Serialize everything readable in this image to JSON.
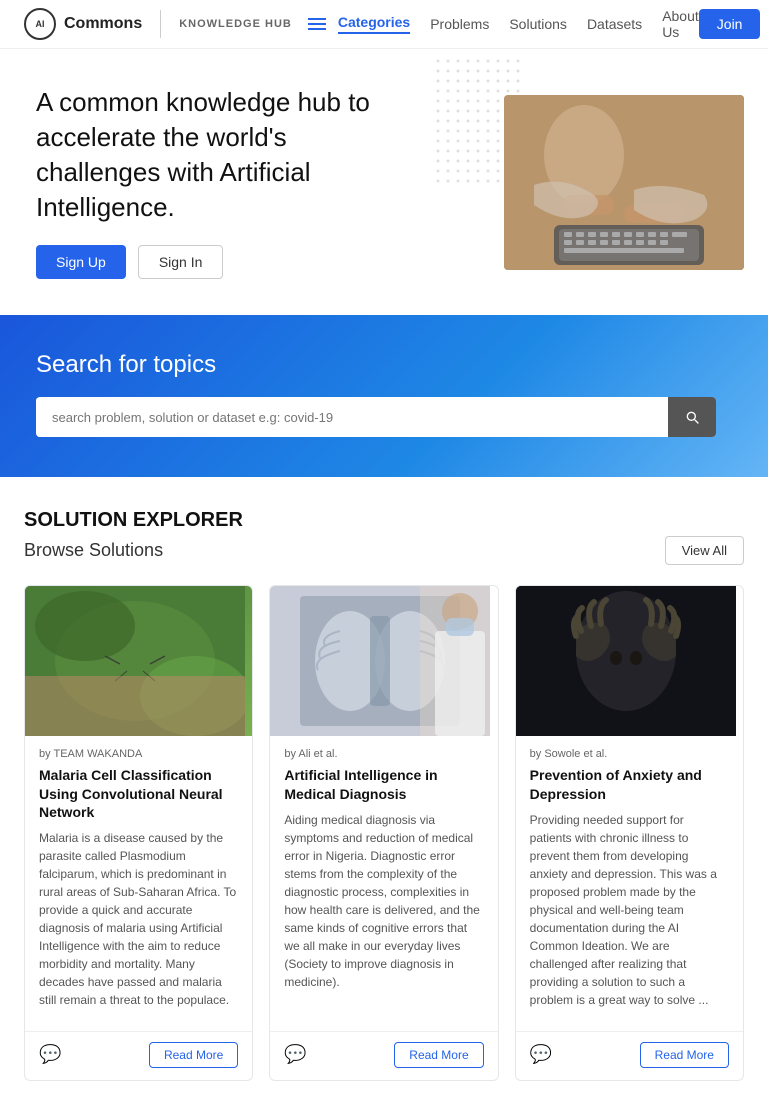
{
  "header": {
    "logo_ai": "AI",
    "logo_name": "Commons",
    "knowledge_hub": "KNOWLEDGE HUB",
    "nav_items": [
      {
        "id": "categories",
        "label": "Categories",
        "active": true
      },
      {
        "id": "problems",
        "label": "Problems",
        "active": false
      },
      {
        "id": "solutions",
        "label": "Solutions",
        "active": false
      },
      {
        "id": "datasets",
        "label": "Datasets",
        "active": false
      },
      {
        "id": "about-us",
        "label": "About Us",
        "active": false
      }
    ],
    "join_btn": "Join"
  },
  "hero": {
    "heading": "A common knowledge hub to accelerate the world's challenges with Artificial Intelligence.",
    "signup_btn": "Sign Up",
    "signin_btn": "Sign In",
    "image_emoji": "🖥️"
  },
  "search": {
    "heading": "Search for topics",
    "placeholder": "search problem, solution or dataset e.g: covid-19"
  },
  "solution_explorer": {
    "title": "SOLUTION EXPLORER",
    "subtitle": "Browse Solutions",
    "view_all": "View All",
    "cards": [
      {
        "author": "by TEAM WAKANDA",
        "title": "Malaria Cell Classification Using Convolutional Neural Network",
        "description": "Malaria is a disease caused by the parasite called Plasmodium falciparum, which is predominant in rural areas of Sub-Saharan Africa. To provide a quick and accurate diagnosis of malaria using Artificial Intelligence with the aim to reduce morbidity and mortality. Many decades have passed and malaria still remain a threat to the populace.",
        "read_more": "Read More",
        "img_color": "#4a7c3f",
        "img_emoji": "🦟"
      },
      {
        "author": "by Ali et al.",
        "title": "Artificial Intelligence in Medical Diagnosis",
        "description": "Aiding medical diagnosis via symptoms and reduction of medical error in Nigeria. Diagnostic error stems from the complexity of the diagnostic process, complexities in how health care is delivered, and the same kinds of cognitive errors that we all make in our everyday lives (Society to improve diagnosis in medicine).",
        "read_more": "Read More",
        "img_color": "#c0c8d8",
        "img_emoji": "🩻"
      },
      {
        "author": "by Sowole et al.",
        "title": "Prevention of Anxiety and Depression",
        "description": "Providing needed support for patients with chronic illness to prevent them from developing anxiety and depression. This was a proposed problem made by the physical and well-being team documentation during the AI Common Ideation. We are challenged after realizing that providing a solution to such a problem is a great way to solve ...",
        "read_more": "Read More",
        "img_color": "#2a2a3a",
        "img_emoji": "🤯"
      }
    ]
  }
}
